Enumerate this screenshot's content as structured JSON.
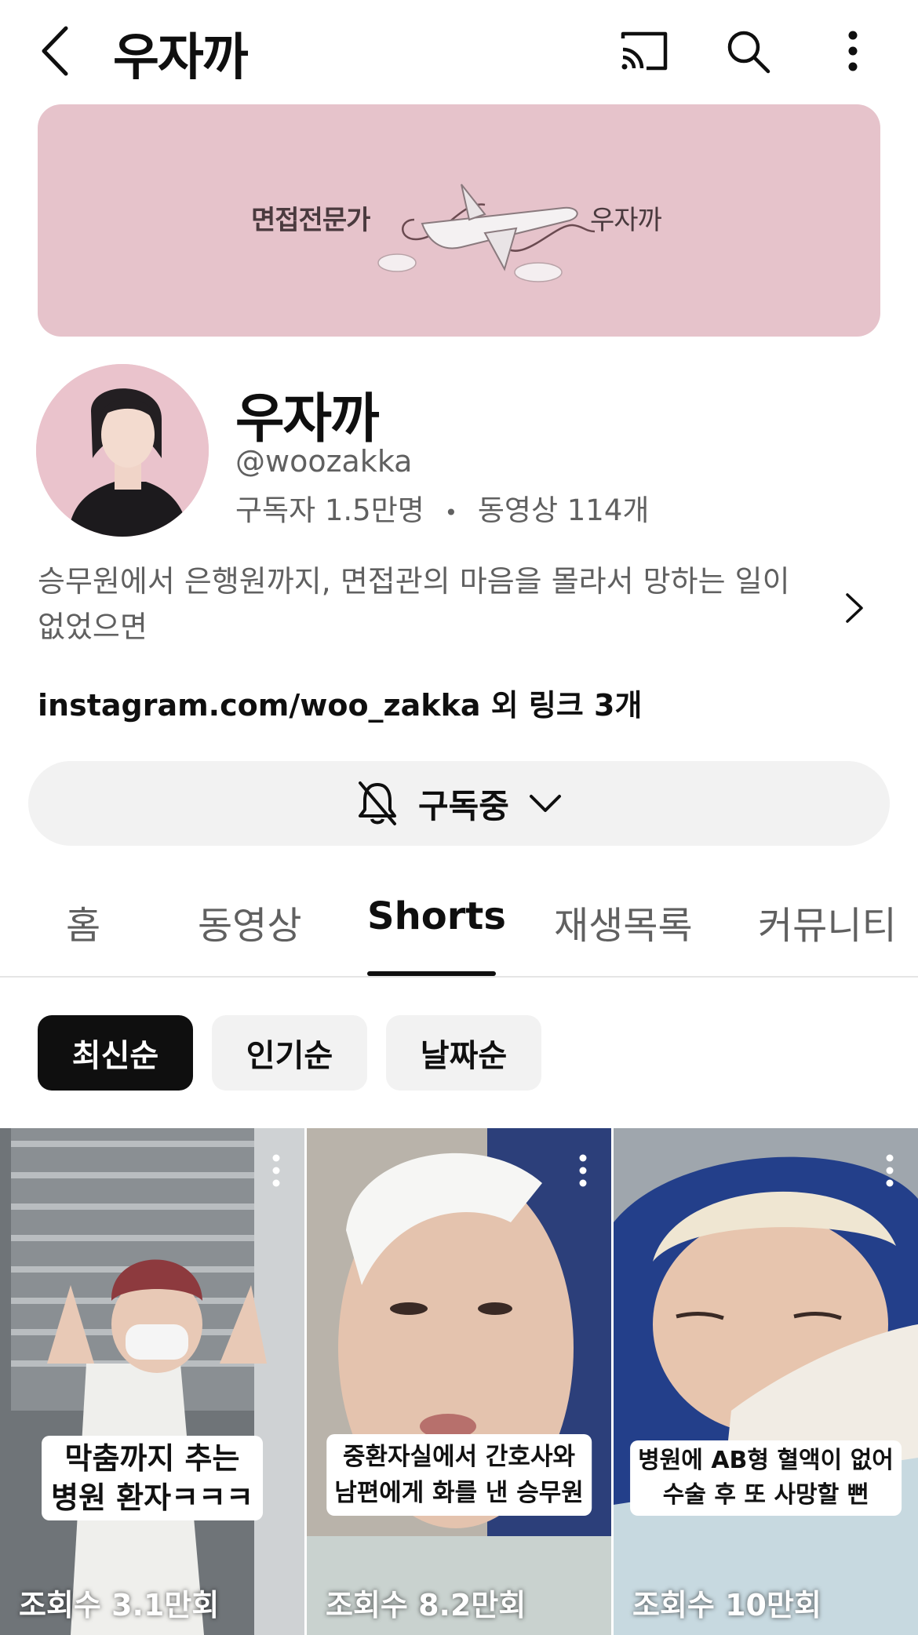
{
  "header": {
    "title": "우자까"
  },
  "banner": {
    "left_text": "면접전문가",
    "right_text": "우자까"
  },
  "channel": {
    "name": "우자까",
    "handle": "@woozakka",
    "subscribers": "구독자 1.5만명",
    "separator": "•",
    "videos": "동영상 114개",
    "description_line1": "승무원에서 은행원까지, 면접관의 마음을 몰라서 망하는 일이",
    "description_line2": "없었으면",
    "links": "instagram.com/woo_zakka 외 링크 3개"
  },
  "subscribe": {
    "label": "구독중"
  },
  "tabs": [
    {
      "label": "홈"
    },
    {
      "label": "동영상"
    },
    {
      "label": "Shorts"
    },
    {
      "label": "재생목록"
    },
    {
      "label": "커뮤니티"
    }
  ],
  "chips": [
    {
      "label": "최신순"
    },
    {
      "label": "인기순"
    },
    {
      "label": "날짜순"
    }
  ],
  "shorts": [
    {
      "caption_line1": "막춤까지 추는",
      "caption_line2": "병원 환자ㅋㅋㅋ",
      "views": "조회수 3.1만회"
    },
    {
      "caption_line1": "중환자실에서 간호사와",
      "caption_line2": "남편에게 화를 낸 승무원",
      "views": "조회수 8.2만회"
    },
    {
      "caption_line1": "병원에 AB형 혈액이 없어",
      "caption_line2": "수술 후 또 사망할 뻔",
      "views": "조회수 10만회"
    }
  ],
  "icons": {
    "back": "chevron-left-icon",
    "cast": "cast-icon",
    "search": "search-icon",
    "more": "more-vert-icon",
    "bell": "bell-off-icon",
    "dropdown": "chevron-down-icon",
    "desc_more": "chevron-right-icon"
  },
  "colors": {
    "banner_bg": "#e6c3cb",
    "active_chip": "#0f0f0f",
    "secondary_text": "#606060"
  }
}
